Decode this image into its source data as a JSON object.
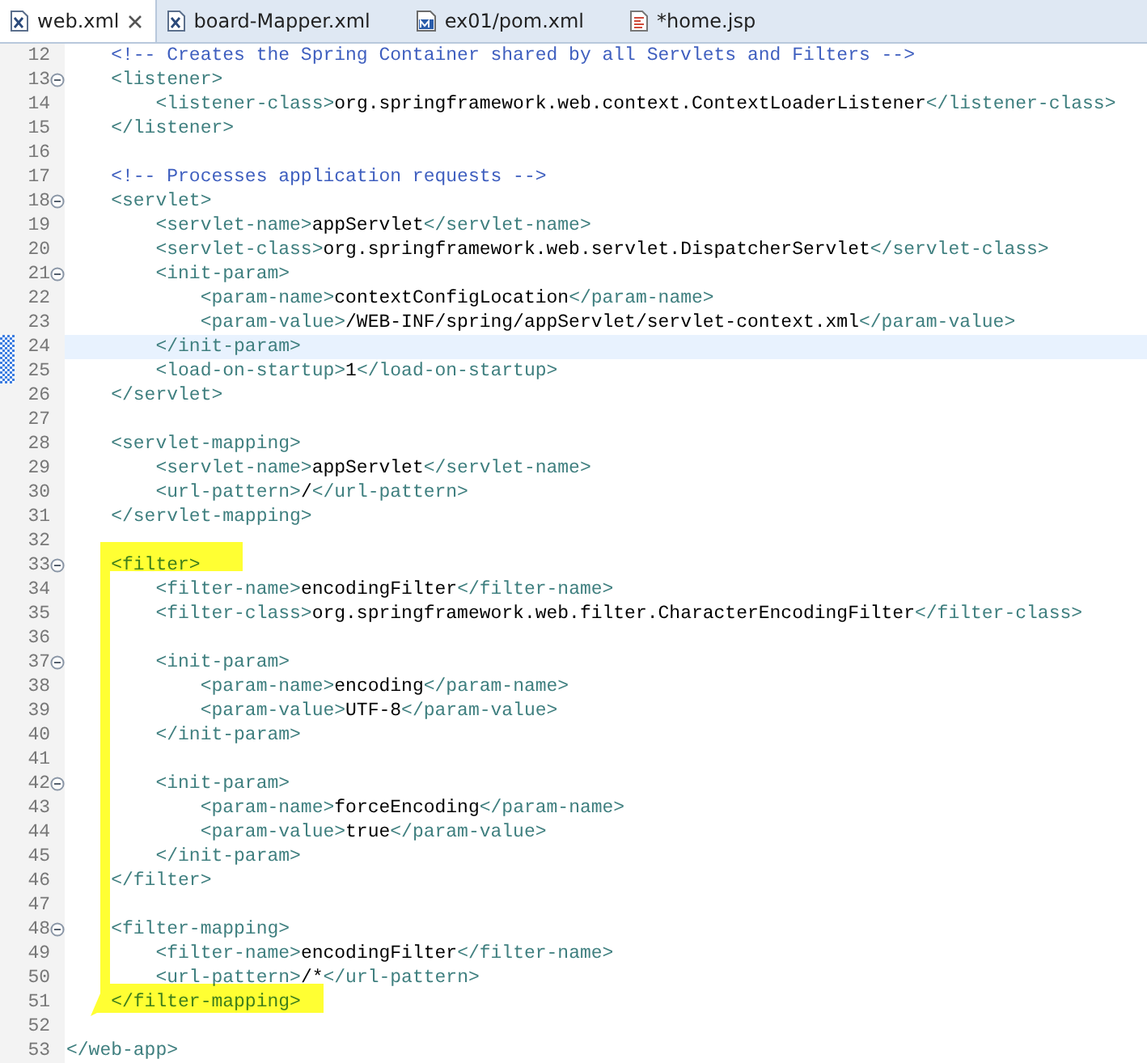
{
  "tabs": [
    {
      "label": "web.xml",
      "kind": "xml",
      "selected": true,
      "closable": true
    },
    {
      "label": "board-Mapper.xml",
      "kind": "xml",
      "selected": false,
      "closable": false
    },
    {
      "label": "ex01/pom.xml",
      "kind": "maven",
      "selected": false,
      "closable": false
    },
    {
      "label": "*home.jsp",
      "kind": "jsp",
      "selected": false,
      "closable": false
    }
  ],
  "editor": {
    "lines": [
      {
        "number": "12",
        "foldable": false,
        "current": false,
        "changed": false,
        "segments": [
          {
            "kind": "comment",
            "text": "    <!-- Creates the Spring Container shared by all Servlets and Filters -->"
          }
        ]
      },
      {
        "number": "13",
        "foldable": true,
        "current": false,
        "changed": false,
        "segments": [
          {
            "kind": "tag",
            "text": "    <listener>"
          }
        ]
      },
      {
        "number": "14",
        "foldable": false,
        "current": false,
        "changed": false,
        "segments": [
          {
            "kind": "tag",
            "text": "        <listener-class>"
          },
          {
            "kind": "text",
            "text": "org.springframework.web.context.ContextLoaderListener"
          },
          {
            "kind": "tag",
            "text": "</listener-class>"
          }
        ]
      },
      {
        "number": "15",
        "foldable": false,
        "current": false,
        "changed": false,
        "segments": [
          {
            "kind": "tag",
            "text": "    </listener>"
          }
        ]
      },
      {
        "number": "16",
        "foldable": false,
        "current": false,
        "changed": false
      },
      {
        "number": "17",
        "foldable": false,
        "current": false,
        "changed": false,
        "segments": [
          {
            "kind": "comment",
            "text": "    <!-- Processes application requests -->"
          }
        ]
      },
      {
        "number": "18",
        "foldable": true,
        "current": false,
        "changed": false,
        "segments": [
          {
            "kind": "tag",
            "text": "    <servlet>"
          }
        ]
      },
      {
        "number": "19",
        "foldable": false,
        "current": false,
        "changed": false,
        "segments": [
          {
            "kind": "tag",
            "text": "        <servlet-name>"
          },
          {
            "kind": "text",
            "text": "appServlet"
          },
          {
            "kind": "tag",
            "text": "</servlet-name>"
          }
        ]
      },
      {
        "number": "20",
        "foldable": false,
        "current": false,
        "changed": false,
        "segments": [
          {
            "kind": "tag",
            "text": "        <servlet-class>"
          },
          {
            "kind": "text",
            "text": "org.springframework.web.servlet.DispatcherServlet"
          },
          {
            "kind": "tag",
            "text": "</servlet-class>"
          }
        ]
      },
      {
        "number": "21",
        "foldable": true,
        "current": false,
        "changed": false,
        "segments": [
          {
            "kind": "tag",
            "text": "        <init-param>"
          }
        ]
      },
      {
        "number": "22",
        "foldable": false,
        "current": false,
        "changed": false,
        "segments": [
          {
            "kind": "tag",
            "text": "            <param-name>"
          },
          {
            "kind": "text",
            "text": "contextConfigLocation"
          },
          {
            "kind": "tag",
            "text": "</param-name>"
          }
        ]
      },
      {
        "number": "23",
        "foldable": false,
        "current": false,
        "changed": false,
        "segments": [
          {
            "kind": "tag",
            "text": "            <param-value>"
          },
          {
            "kind": "text",
            "text": "/WEB-INF/spring/appServlet/servlet-context.xml"
          },
          {
            "kind": "tag",
            "text": "</param-value>"
          }
        ]
      },
      {
        "number": "24",
        "foldable": false,
        "current": true,
        "changed": true,
        "segments": [
          {
            "kind": "tag",
            "text": "        </init-param>"
          }
        ]
      },
      {
        "number": "25",
        "foldable": false,
        "current": false,
        "changed": true,
        "segments": [
          {
            "kind": "tag",
            "text": "        <load-on-startup>"
          },
          {
            "kind": "text",
            "text": "1"
          },
          {
            "kind": "tag",
            "text": "</load-on-startup>"
          }
        ]
      },
      {
        "number": "26",
        "foldable": false,
        "current": false,
        "changed": false,
        "segments": [
          {
            "kind": "tag",
            "text": "    </servlet>"
          }
        ]
      },
      {
        "number": "27",
        "foldable": false,
        "current": false,
        "changed": false
      },
      {
        "number": "28",
        "foldable": false,
        "current": false,
        "changed": false,
        "segments": [
          {
            "kind": "tag",
            "text": "    <servlet-mapping>"
          }
        ]
      },
      {
        "number": "29",
        "foldable": false,
        "current": false,
        "changed": false,
        "segments": [
          {
            "kind": "tag",
            "text": "        <servlet-name>"
          },
          {
            "kind": "text",
            "text": "appServlet"
          },
          {
            "kind": "tag",
            "text": "</servlet-name>"
          }
        ]
      },
      {
        "number": "30",
        "foldable": false,
        "current": false,
        "changed": false,
        "segments": [
          {
            "kind": "tag",
            "text": "        <url-pattern>"
          },
          {
            "kind": "text",
            "text": "/"
          },
          {
            "kind": "tag",
            "text": "</url-pattern>"
          }
        ]
      },
      {
        "number": "31",
        "foldable": false,
        "current": false,
        "changed": false,
        "segments": [
          {
            "kind": "tag",
            "text": "    </servlet-mapping>"
          }
        ]
      },
      {
        "number": "32",
        "foldable": false,
        "current": false,
        "changed": false
      },
      {
        "number": "33",
        "foldable": true,
        "current": false,
        "changed": false,
        "segments": [
          {
            "kind": "tag",
            "text": "    <filter>"
          }
        ]
      },
      {
        "number": "34",
        "foldable": false,
        "current": false,
        "changed": false,
        "segments": [
          {
            "kind": "tag",
            "text": "        <filter-name>"
          },
          {
            "kind": "text",
            "text": "encodingFilter"
          },
          {
            "kind": "tag",
            "text": "</filter-name>"
          }
        ]
      },
      {
        "number": "35",
        "foldable": false,
        "current": false,
        "changed": false,
        "segments": [
          {
            "kind": "tag",
            "text": "        <filter-class>"
          },
          {
            "kind": "text",
            "text": "org.springframework.web.filter.CharacterEncodingFilter"
          },
          {
            "kind": "tag",
            "text": "</filter-class>"
          }
        ]
      },
      {
        "number": "36",
        "foldable": false,
        "current": false,
        "changed": false
      },
      {
        "number": "37",
        "foldable": true,
        "current": false,
        "changed": false,
        "segments": [
          {
            "kind": "tag",
            "text": "        <init-param>"
          }
        ]
      },
      {
        "number": "38",
        "foldable": false,
        "current": false,
        "changed": false,
        "segments": [
          {
            "kind": "tag",
            "text": "            <param-name>"
          },
          {
            "kind": "text",
            "text": "encoding"
          },
          {
            "kind": "tag",
            "text": "</param-name>"
          }
        ]
      },
      {
        "number": "39",
        "foldable": false,
        "current": false,
        "changed": false,
        "segments": [
          {
            "kind": "tag",
            "text": "            <param-value>"
          },
          {
            "kind": "text",
            "text": "UTF-8"
          },
          {
            "kind": "tag",
            "text": "</param-value>"
          }
        ]
      },
      {
        "number": "40",
        "foldable": false,
        "current": false,
        "changed": false,
        "segments": [
          {
            "kind": "tag",
            "text": "        </init-param>"
          }
        ]
      },
      {
        "number": "41",
        "foldable": false,
        "current": false,
        "changed": false
      },
      {
        "number": "42",
        "foldable": true,
        "current": false,
        "changed": false,
        "segments": [
          {
            "kind": "tag",
            "text": "        <init-param>"
          }
        ]
      },
      {
        "number": "43",
        "foldable": false,
        "current": false,
        "changed": false,
        "segments": [
          {
            "kind": "tag",
            "text": "            <param-name>"
          },
          {
            "kind": "text",
            "text": "forceEncoding"
          },
          {
            "kind": "tag",
            "text": "</param-name>"
          }
        ]
      },
      {
        "number": "44",
        "foldable": false,
        "current": false,
        "changed": false,
        "segments": [
          {
            "kind": "tag",
            "text": "            <param-value>"
          },
          {
            "kind": "text",
            "text": "true"
          },
          {
            "kind": "tag",
            "text": "</param-value>"
          }
        ]
      },
      {
        "number": "45",
        "foldable": false,
        "current": false,
        "changed": false,
        "segments": [
          {
            "kind": "tag",
            "text": "        </init-param>"
          }
        ]
      },
      {
        "number": "46",
        "foldable": false,
        "current": false,
        "changed": false,
        "segments": [
          {
            "kind": "tag",
            "text": "    </filter>"
          }
        ]
      },
      {
        "number": "47",
        "foldable": false,
        "current": false,
        "changed": false
      },
      {
        "number": "48",
        "foldable": true,
        "current": false,
        "changed": false,
        "segments": [
          {
            "kind": "tag",
            "text": "    <filter-mapping>"
          }
        ]
      },
      {
        "number": "49",
        "foldable": false,
        "current": false,
        "changed": false,
        "segments": [
          {
            "kind": "tag",
            "text": "        <filter-name>"
          },
          {
            "kind": "text",
            "text": "encodingFilter"
          },
          {
            "kind": "tag",
            "text": "</filter-name>"
          }
        ]
      },
      {
        "number": "50",
        "foldable": false,
        "current": false,
        "changed": false,
        "segments": [
          {
            "kind": "tag",
            "text": "        <url-pattern>"
          },
          {
            "kind": "text",
            "text": "/*"
          },
          {
            "kind": "tag",
            "text": "</url-pattern>"
          }
        ]
      },
      {
        "number": "51",
        "foldable": false,
        "current": false,
        "changed": false,
        "segments": [
          {
            "kind": "tag",
            "text": "    </filter-mapping>"
          }
        ]
      },
      {
        "number": "52",
        "foldable": false,
        "current": false,
        "changed": false
      },
      {
        "number": "53",
        "foldable": false,
        "current": false,
        "changed": false,
        "segments": [
          {
            "kind": "tag",
            "text": "</web-app>"
          }
        ]
      }
    ]
  }
}
